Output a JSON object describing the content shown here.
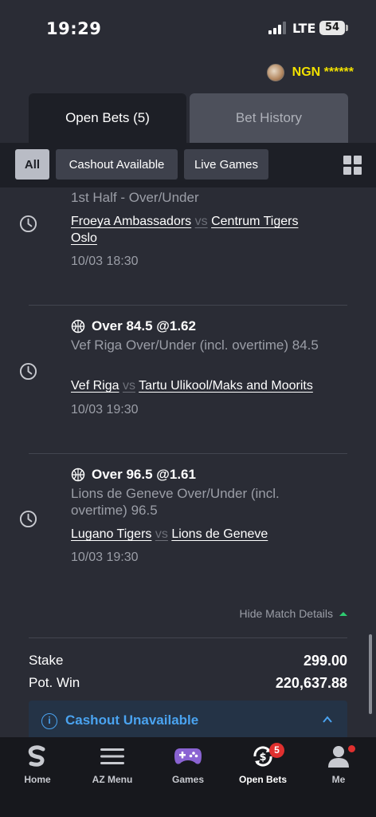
{
  "status": {
    "time": "19:29",
    "network": "LTE",
    "battery": "54"
  },
  "account": {
    "balance_label": "NGN ******"
  },
  "tabs": {
    "open_bets": "Open Bets (5)",
    "bet_history": "Bet History"
  },
  "filters": {
    "all": "All",
    "cashout": "Cashout Available",
    "live": "Live Games"
  },
  "bets": [
    {
      "market": "1st Half  -  Over/Under",
      "team1": "Froeya Ambassadors",
      "vs": "vs",
      "team2": "Centrum Tigers Oslo",
      "date": "10/03 18:30"
    },
    {
      "title": "Over 84.5 @1.62",
      "market": "Vef Riga Over/Under (incl. overtime) 84.5",
      "team1": "Vef Riga",
      "vs": "vs",
      "team2": "Tartu Ulikool/Maks and Moorits",
      "date": "10/03 19:30"
    },
    {
      "title": "Over 96.5 @1.61",
      "market": "Lions de Geneve Over/Under (incl. overtime) 96.5",
      "team1": "Lugano Tigers",
      "vs": "vs",
      "team2": "Lions de Geneve",
      "date": "10/03 19:30"
    }
  ],
  "details": {
    "hide_label": "Hide Match Details"
  },
  "summary": {
    "stake_label": "Stake",
    "stake_value": "299.00",
    "win_label": "Pot. Win",
    "win_value": "220,637.88"
  },
  "cashout": {
    "label": "Cashout Unavailable"
  },
  "nav": [
    {
      "label": "Home",
      "icon": "home-s-icon"
    },
    {
      "label": "AZ Menu",
      "icon": "menu-icon"
    },
    {
      "label": "Games",
      "icon": "gamepad-icon"
    },
    {
      "label": "Open Bets",
      "icon": "open-bets-icon",
      "badge": "5"
    },
    {
      "label": "Me",
      "icon": "user-icon"
    }
  ],
  "colors": {
    "accent_yellow": "#f0e000",
    "info_blue": "#4aa3f0",
    "badge_red": "#e0302f",
    "background": "#2a2c35"
  }
}
